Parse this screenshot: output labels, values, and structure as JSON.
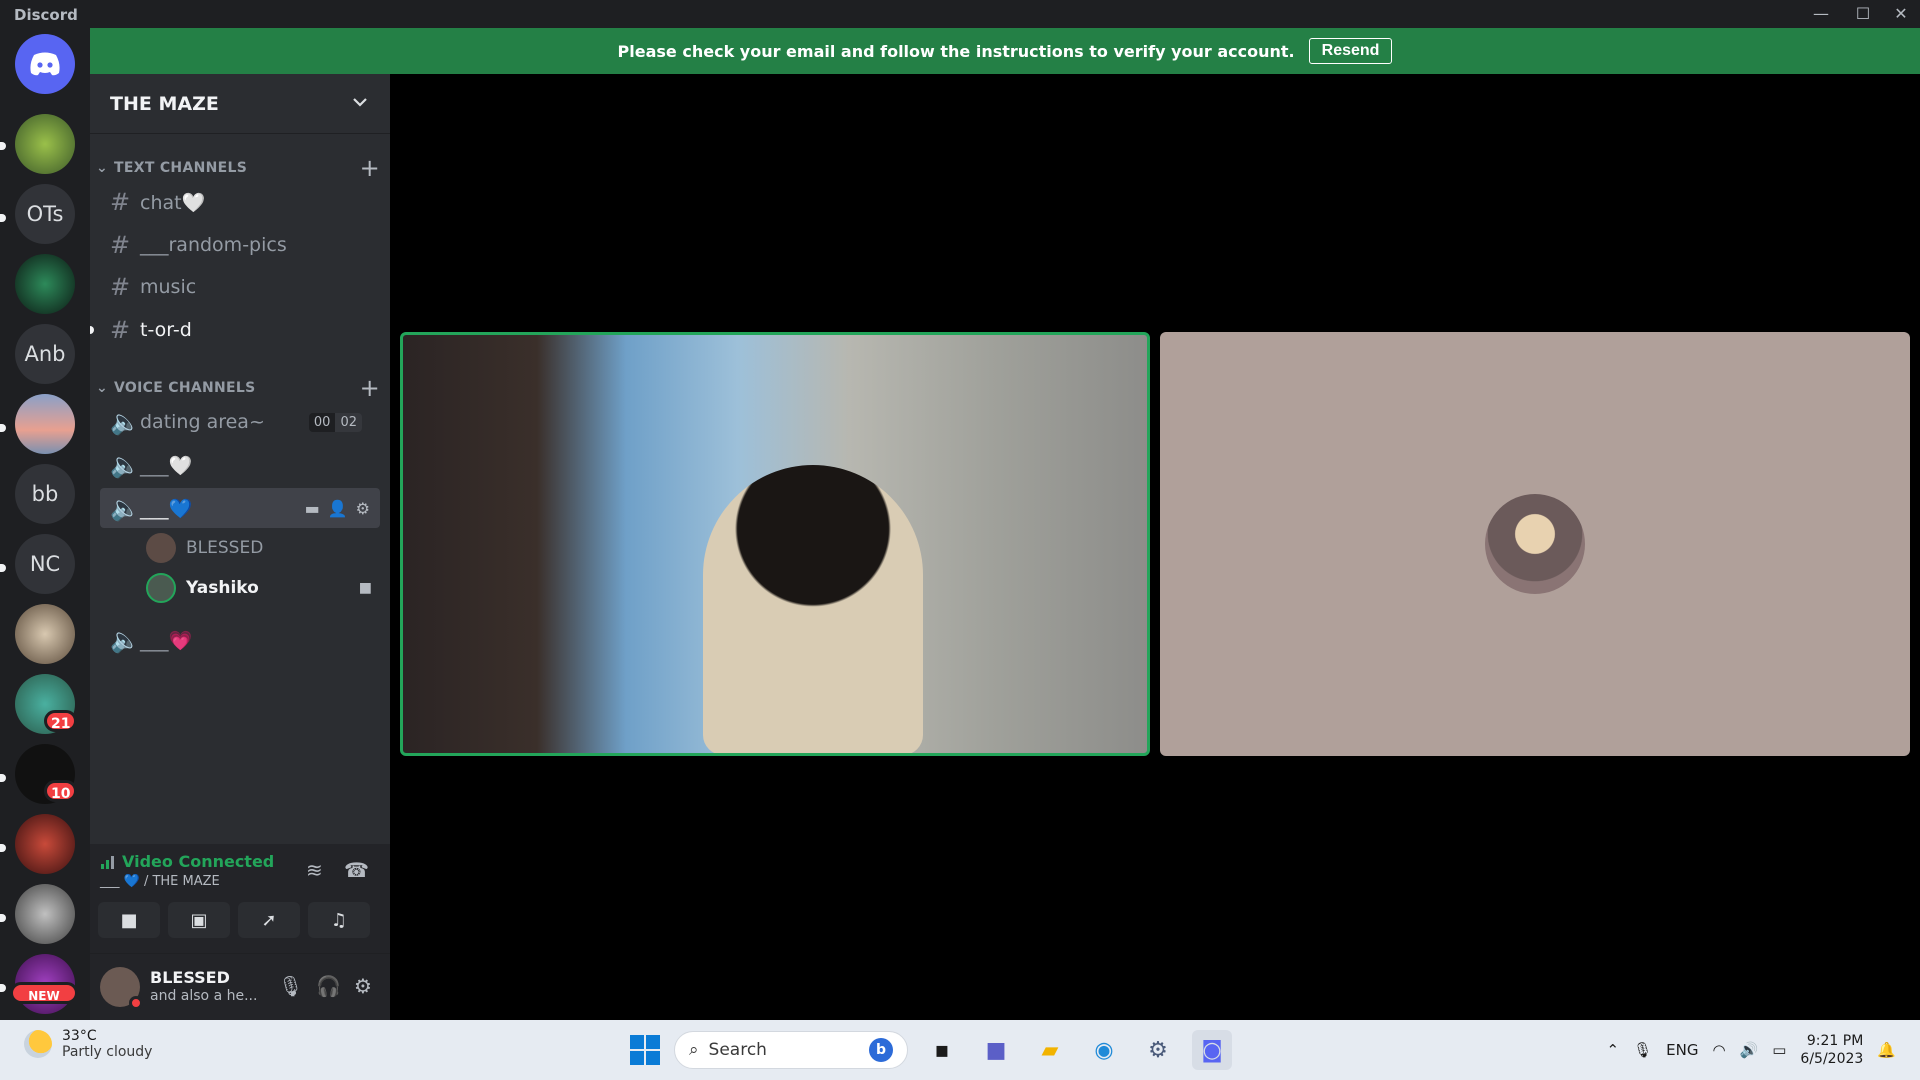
{
  "window": {
    "title": "Discord",
    "minimize": "—",
    "maximize": "☐",
    "close": "✕"
  },
  "banner": {
    "message": "Please check your email and follow the instructions to verify your account.",
    "resend_label": "Resend"
  },
  "servers": [
    {
      "label": ""
    },
    {
      "label": "OTs"
    },
    {
      "label": ""
    },
    {
      "label": "Anb"
    },
    {
      "label": ""
    },
    {
      "label": "bb"
    },
    {
      "label": "NC"
    },
    {
      "label": ""
    },
    {
      "label": "",
      "badge": "21"
    },
    {
      "label": "",
      "badge": "10"
    },
    {
      "label": ""
    },
    {
      "label": ""
    },
    {
      "label": "",
      "badge": "NEW"
    }
  ],
  "sidebar": {
    "server_name": "THE MAZE",
    "text_category": "TEXT CHANNELS",
    "text_channels": [
      "chat🤍",
      "___random-pics",
      "music",
      "t-or-d"
    ],
    "voice_category": "VOICE CHANNELS",
    "voice_channels": [
      {
        "name": "dating area~",
        "count_a": "00",
        "count_b": "02"
      },
      {
        "name": "___🤍"
      },
      {
        "name": "___💙"
      },
      {
        "name": "___💗"
      }
    ],
    "members": [
      "BLESSED",
      "Yashiko"
    ]
  },
  "voice_panel": {
    "status": "Video Connected",
    "location": "___ 💙 / THE MAZE"
  },
  "user_panel": {
    "username": "BLESSED",
    "status": "and also a he..."
  },
  "taskbar": {
    "temperature": "33°C",
    "weather": "Partly cloudy",
    "search_placeholder": "Search",
    "language": "ENG",
    "time": "9:21 PM",
    "date": "6/5/2023"
  },
  "colors": {
    "accent_green": "#23a55a",
    "banner_green": "#248046",
    "alert_red": "#f23f42"
  }
}
